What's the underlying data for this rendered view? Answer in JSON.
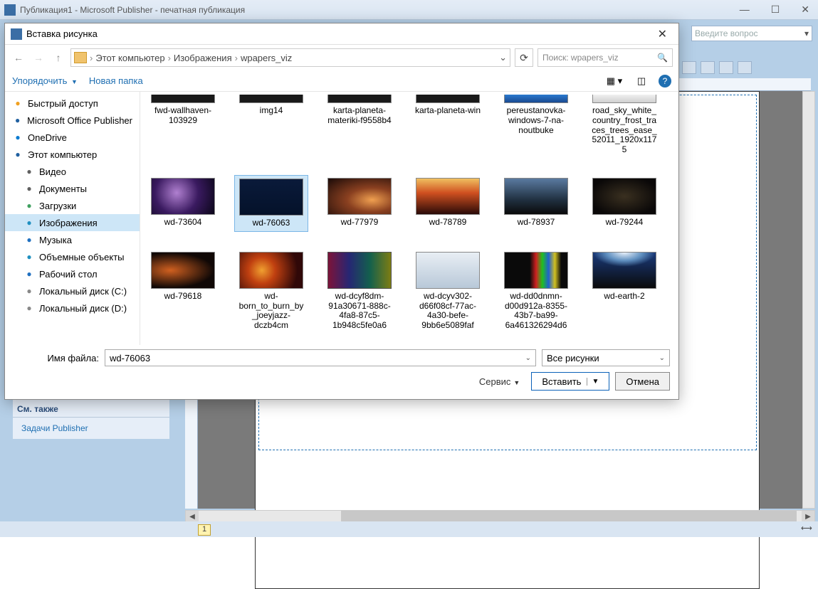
{
  "publisher": {
    "title": "Публикация1 - Microsoft Publisher - печатная публикация",
    "helpbox_placeholder": "Введите вопрос",
    "sidepanel": {
      "heading": "См. также",
      "link": "Задачи Publisher"
    },
    "page_number": "1"
  },
  "dialog": {
    "title": "Вставка рисунка",
    "breadcrumb": [
      "Этот компьютер",
      "Изображения",
      "wpapers_viz"
    ],
    "search_placeholder": "Поиск: wpapers_viz",
    "organize": "Упорядочить",
    "new_folder": "Новая папка",
    "navitems": [
      {
        "label": "Быстрый доступ",
        "cls": "star"
      },
      {
        "label": "Microsoft Office Publisher",
        "cls": "pub"
      },
      {
        "label": "OneDrive",
        "cls": "cloud"
      },
      {
        "label": "Этот компьютер",
        "cls": "pc"
      },
      {
        "label": "Видео",
        "cls": "vid",
        "sub": true
      },
      {
        "label": "Документы",
        "cls": "doc",
        "sub": true
      },
      {
        "label": "Загрузки",
        "cls": "dl",
        "sub": true
      },
      {
        "label": "Изображения",
        "cls": "img",
        "sub": true,
        "selected": true
      },
      {
        "label": "Музыка",
        "cls": "mus",
        "sub": true
      },
      {
        "label": "Объемные объекты",
        "cls": "obj3",
        "sub": true
      },
      {
        "label": "Рабочий стол",
        "cls": "desk",
        "sub": true
      },
      {
        "label": "Локальный диск (C:)",
        "cls": "disk",
        "sub": true
      },
      {
        "label": "Локальный диск (D:)",
        "cls": "disk",
        "sub": true
      }
    ],
    "files_row1": [
      {
        "name": "fwd-wallhaven-103929",
        "thumb": "dark",
        "partial": true
      },
      {
        "name": "img14",
        "thumb": "dark",
        "partial": true
      },
      {
        "name": "karta-planeta-materiki-f9558b4",
        "thumb": "dark",
        "partial": true
      },
      {
        "name": "karta-planeta-win",
        "thumb": "dark",
        "partial": true
      },
      {
        "name": "pereustanovka-windows-7-na-noutbuke",
        "thumb": "blue",
        "partial": true
      },
      {
        "name": "road_sky_white_country_frost_traces_trees_ease_52011_1920x1175",
        "thumb": "white",
        "partial": true
      }
    ],
    "files_row2": [
      {
        "name": "wd-73604",
        "thumb": "space1"
      },
      {
        "name": "wd-76063",
        "thumb": "space2",
        "selected": true
      },
      {
        "name": "wd-77979",
        "thumb": "space3"
      },
      {
        "name": "wd-78789",
        "thumb": "space4"
      },
      {
        "name": "wd-78937",
        "thumb": "space5"
      },
      {
        "name": "wd-79244",
        "thumb": "space6"
      }
    ],
    "files_row3": [
      {
        "name": "wd-79618",
        "thumb": "space7"
      },
      {
        "name": "wd-born_to_burn_by_joeyjazz-dczb4cm",
        "thumb": "sun"
      },
      {
        "name": "wd-dcyf8dm-91a30671-888c-4fa8-87c5-1b948c5fe0a6",
        "thumb": "rainbow"
      },
      {
        "name": "wd-dcyv302-d66f08cf-77ac-4a30-befe-9bb6e5089faf",
        "thumb": "clouds"
      },
      {
        "name": "wd-dd0dnmn-d00d912a-8355-43b7-ba99-6a461326294d6",
        "thumb": "winrb"
      },
      {
        "name": "wd-earth-2",
        "thumb": "earth"
      }
    ],
    "footer": {
      "filename_label": "Имя файла:",
      "filename_value": "wd-76063",
      "filter": "Все рисунки",
      "service": "Сервис",
      "insert": "Вставить",
      "cancel": "Отмена"
    }
  }
}
